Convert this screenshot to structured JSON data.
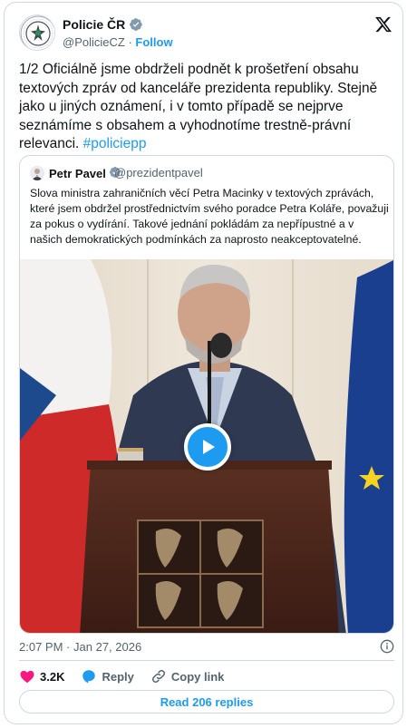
{
  "author": {
    "name": "Policie ČR",
    "handle": "@PolicieCZ",
    "separator": "·",
    "follow_label": "Follow",
    "avatar_ring_text": "POLICIE ČESKÉ REPUBLIKY"
  },
  "tweet": {
    "text": "1/2 Oficiálně jsme obdrželi podnět k prošetření obsahu textových zpráv od kanceláře prezidenta republiky. Stejně jako u jiných oznámení, i v tomto případě se nejprve seznámíme s obsahem a vyhodnotíme trestně-právní relevanci. ",
    "hashtag": "#policiepp"
  },
  "quoted": {
    "name": "Petr Pavel",
    "handle": "@prezidentpavel",
    "text": "Slova ministra zahraničních věcí Petra Macinky v textových zprávách, které jsem obdržel prostřednictvím svého poradce Petra Koláře, považuji za pokus o vydírání. Takové jednání pokládám za nepřípustné a v našich demokratických podmínkách za naprosto neakceptovatelné.",
    "media_type": "video"
  },
  "meta": {
    "time": "2:07 PM",
    "separator": "·",
    "date": "Jan 27, 2026"
  },
  "actions": {
    "like_count": "3.2K",
    "reply_label": "Reply",
    "copy_link_label": "Copy link"
  },
  "replies_button": "Read 206 replies",
  "colors": {
    "accent": "#1d9bf0",
    "like": "#f91880",
    "verified": "#829aab",
    "text": "#0f1419",
    "secondary": "#536471"
  },
  "icons": [
    "x-logo-icon",
    "verified-badge-icon",
    "heart-icon",
    "reply-icon",
    "link-icon",
    "info-icon",
    "play-icon"
  ]
}
